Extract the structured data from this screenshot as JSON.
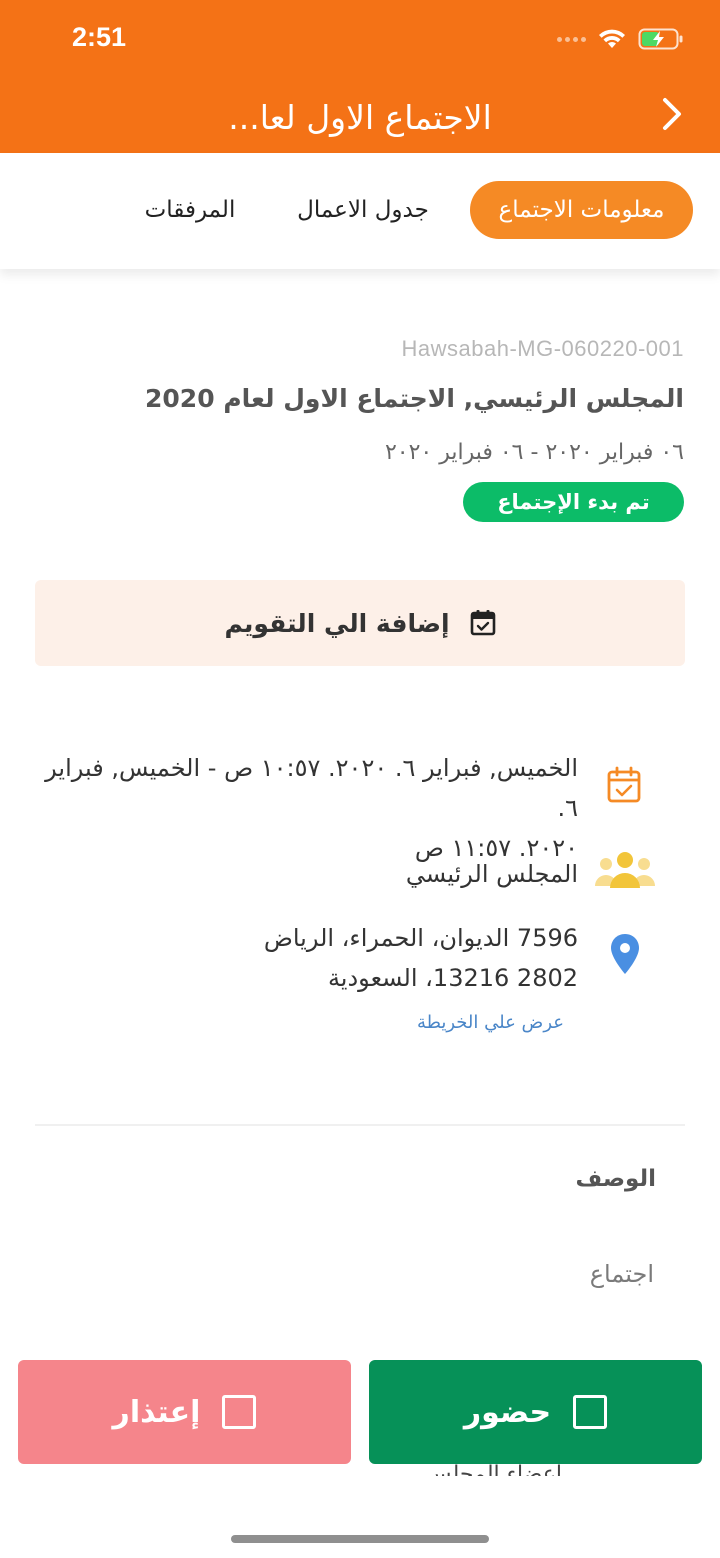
{
  "status_bar": {
    "time": "2:51"
  },
  "header": {
    "title": "الاجتماع الاول لعا..."
  },
  "tabs": [
    {
      "label": "معلومات الاجتماع",
      "active": true
    },
    {
      "label": "جدول الاعمال",
      "active": false
    },
    {
      "label": "المرفقات",
      "active": false
    }
  ],
  "meeting": {
    "code": "Hawsabah-MG-060220-001",
    "name": "المجلس الرئيسي, الاجتماع الاول لعام 2020",
    "date_range": "٠٦ فبراير ٢٠٢٠ - ٠٦ فبراير ٢٠٢٠",
    "status": "تم بدء الإجتماع"
  },
  "add_calendar": {
    "label": "إضافة الي التقويم"
  },
  "details": {
    "datetime_line1": "الخميس, فبراير ٦. ٢٠٢٠. ١٠:٥٧ ص - الخميس, فبراير ٦.",
    "datetime_line2": "٢٠٢٠. ١١:٥٧ ص",
    "committee": "المجلس الرئيسي",
    "address_line1": "7596 الديوان، الحمراء، الرياض",
    "address_line2": "2802 13216، السعودية",
    "map_link": "عرض علي الخريطة"
  },
  "description": {
    "title": "الوصف",
    "text": "اجتماع",
    "partial_next_section": "اعضاء المجلس"
  },
  "actions": {
    "attend": "حضور",
    "apology": "إعتذار"
  },
  "colors": {
    "brand_orange": "#f47216",
    "status_green": "#0cbc68",
    "attend_green": "#069158",
    "apology_pink": "#f5858b",
    "link_blue": "#4a86c8"
  }
}
